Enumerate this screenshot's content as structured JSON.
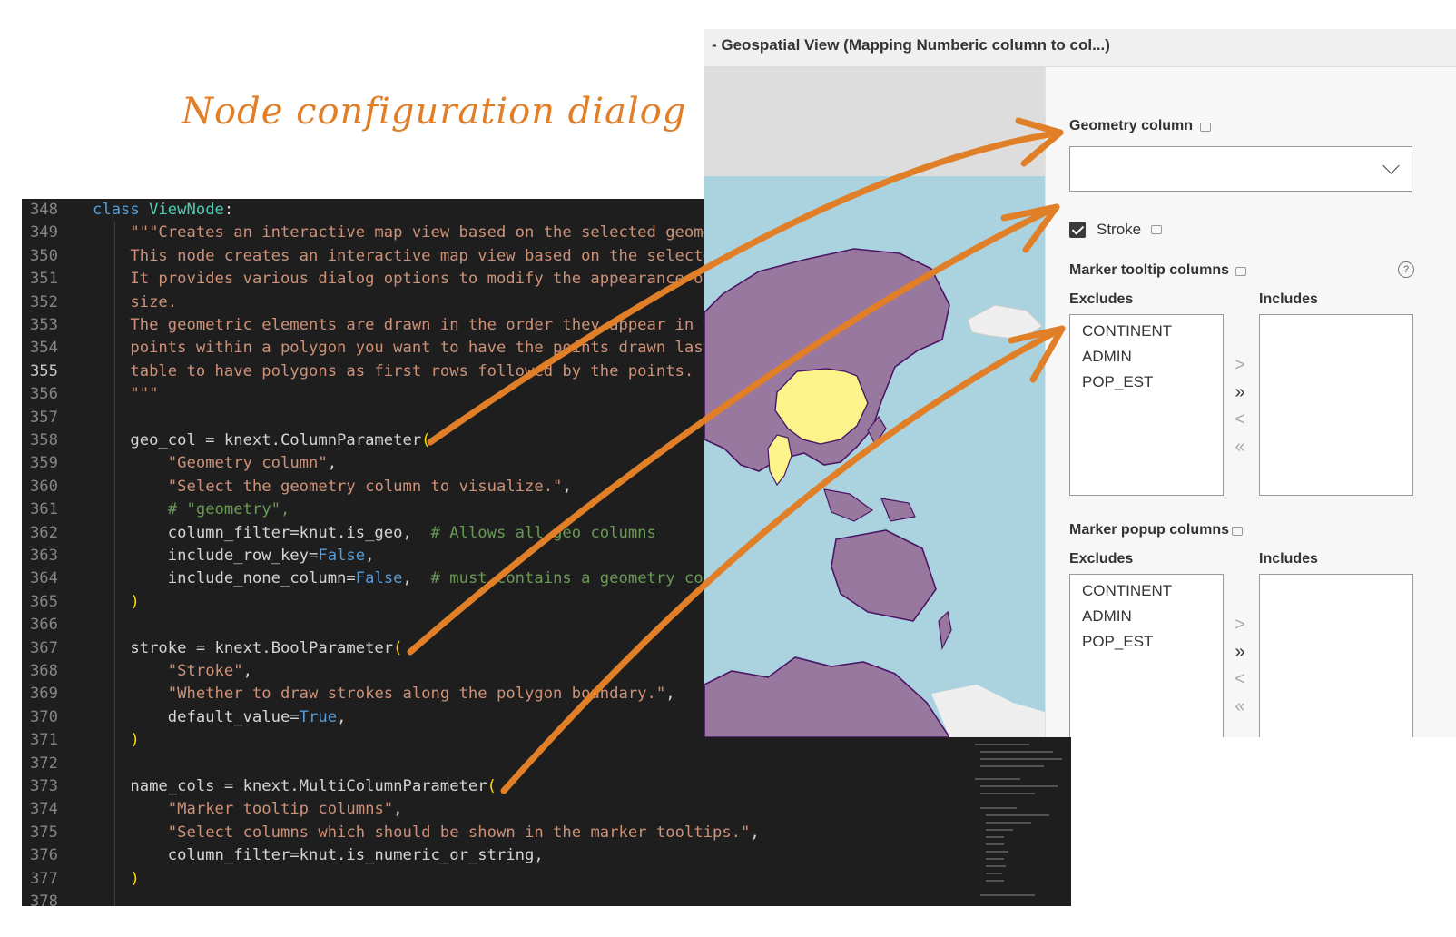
{
  "annotation_title": "Node configuration dialog",
  "code": {
    "active_line": "355",
    "lines": [
      {
        "n": "348",
        "t": "class ViewNode:"
      },
      {
        "n": "349",
        "t": "    \"\"\"Creates an interactive map view based on the selected geome"
      },
      {
        "n": "350",
        "t": "    This node creates an interactive map view based on the selecte"
      },
      {
        "n": "351",
        "t": "    It provides various dialog options to modify the appearance of"
      },
      {
        "n": "352",
        "t": "    size."
      },
      {
        "n": "353",
        "t": "    The geometric elements are drawn in the order they appear in t"
      },
      {
        "n": "354",
        "t": "    points within a polygon you want to have the points drawn last"
      },
      {
        "n": "355",
        "t": "    table to have polygons as first rows followed by the points."
      },
      {
        "n": "356",
        "t": "    \"\"\""
      },
      {
        "n": "357",
        "t": ""
      },
      {
        "n": "358",
        "t": "    geo_col = knext.ColumnParameter("
      },
      {
        "n": "359",
        "t": "        \"Geometry column\","
      },
      {
        "n": "360",
        "t": "        \"Select the geometry column to visualize.\","
      },
      {
        "n": "361",
        "t": "        # \"geometry\","
      },
      {
        "n": "362",
        "t": "        column_filter=knut.is_geo,  # Allows all geo columns"
      },
      {
        "n": "363",
        "t": "        include_row_key=False,"
      },
      {
        "n": "364",
        "t": "        include_none_column=False,  # must contains a geometry col"
      },
      {
        "n": "365",
        "t": "    )"
      },
      {
        "n": "366",
        "t": ""
      },
      {
        "n": "367",
        "t": "    stroke = knext.BoolParameter("
      },
      {
        "n": "368",
        "t": "        \"Stroke\","
      },
      {
        "n": "369",
        "t": "        \"Whether to draw strokes along the polygon boundary.\","
      },
      {
        "n": "370",
        "t": "        default_value=True,"
      },
      {
        "n": "371",
        "t": "    )"
      },
      {
        "n": "372",
        "t": ""
      },
      {
        "n": "373",
        "t": "    name_cols = knext.MultiColumnParameter("
      },
      {
        "n": "374",
        "t": "        \"Marker tooltip columns\","
      },
      {
        "n": "375",
        "t": "        \"Select columns which should be shown in the marker tooltips.\","
      },
      {
        "n": "376",
        "t": "        column_filter=knut.is_numeric_or_string,"
      },
      {
        "n": "377",
        "t": "    )"
      },
      {
        "n": "378",
        "t": ""
      }
    ]
  },
  "dialog": {
    "title": "- Geospatial View (Mapping Numberic column to col...)",
    "geometry_label": "Geometry column",
    "geometry_value": "",
    "stroke_label": "Stroke",
    "stroke_checked": true,
    "tooltip": {
      "label": "Marker tooltip columns",
      "excludes_label": "Excludes",
      "includes_label": "Includes",
      "excludes": [
        "CONTINENT",
        "ADMIN",
        "POP_EST"
      ],
      "includes": []
    },
    "popup": {
      "label": "Marker popup columns",
      "excludes_label": "Excludes",
      "includes_label": "Includes",
      "excludes": [
        "CONTINENT",
        "ADMIN",
        "POP_EST"
      ],
      "includes": []
    },
    "help_icon": "?",
    "move_buttons": [
      ">",
      "»",
      "<",
      "«"
    ]
  },
  "map_colors": {
    "water": "#aad3df",
    "land": "#98789e",
    "highlight": "#fcf48a",
    "border": "#4b1565"
  },
  "annotation_color": "#e07f27",
  "syntax_colors": {
    "keyword": "#569cd6",
    "string": "#ce9178",
    "comment": "#6a9955",
    "class": "#4ec9b0",
    "paren": "#ffd700"
  }
}
